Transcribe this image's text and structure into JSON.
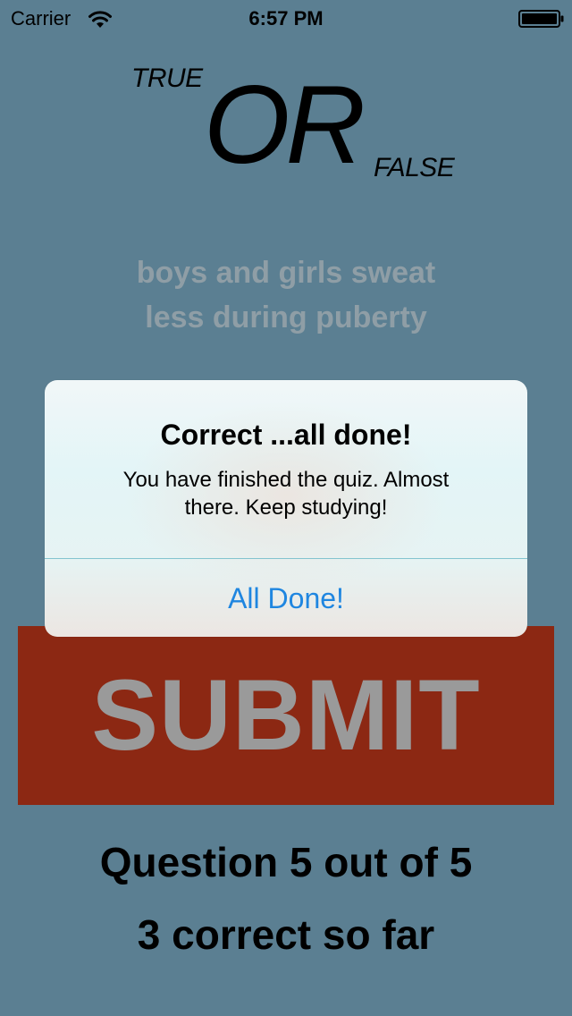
{
  "status_bar": {
    "carrier": "Carrier",
    "time": "6:57 PM",
    "wifi_icon": "wifi-icon",
    "battery_icon": "battery-icon"
  },
  "logo": {
    "true_text": "TRUE",
    "or_text": "OR",
    "false_text": "FALSE"
  },
  "question": {
    "line1": "boys and girls sweat",
    "line2": "less during puberty"
  },
  "submit": {
    "label": "SUBMIT"
  },
  "progress": {
    "question": "Question 5 out of 5",
    "score": "3 correct so far"
  },
  "alert": {
    "title": "Correct ...all done!",
    "message_line1": "You have finished the quiz. Almost",
    "message_line2": "there. Keep studying!",
    "button_label": "All Done!"
  },
  "colors": {
    "background": "#5b7f92",
    "submit_background": "#8c2813",
    "submit_text": "#9a9a9a",
    "alert_button_text": "#1f86e0",
    "question_text": "#8f9ea6"
  }
}
